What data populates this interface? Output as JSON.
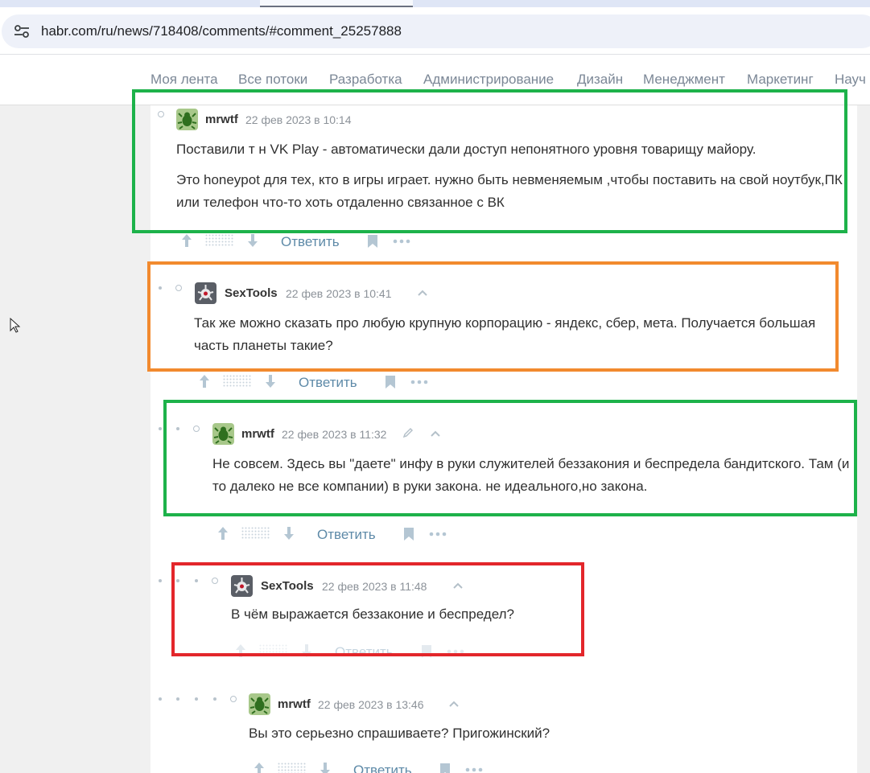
{
  "browser": {
    "url": "habr.com/ru/news/718408/comments/#comment_25257888"
  },
  "nav": {
    "items": [
      "Моя лента",
      "Все потоки",
      "Разработка",
      "Администрирование",
      "Дизайн",
      "Менеджмент",
      "Маркетинг",
      "Науч"
    ]
  },
  "comments": [
    {
      "author": "mrwtf",
      "time": "22 фев 2023 в 10:14",
      "paragraphs": [
        "Поставили т н VK Play - автоматически дали доступ непонятного уровня товарищу майору.",
        "Это honeypot для тех, кто в игры играет. нужно быть невменяемым ,чтобы поставить на свой ноутбук,ПК или телефон что-то хоть отдаленно связанное с ВК"
      ],
      "reply_label": "Ответить",
      "highlight": "green"
    },
    {
      "author": "SexTools",
      "time": "22 фев 2023 в 10:41",
      "paragraphs": [
        "Так же можно сказать про любую крупную корпорацию - яндекс, сбер, мета. Получается большая часть планеты такие?"
      ],
      "reply_label": "Ответить",
      "highlight": "orange"
    },
    {
      "author": "mrwtf",
      "time": "22 фев 2023 в 11:32",
      "paragraphs": [
        "Не совсем. Здесь вы \"даете\" инфу в руки служителей беззакония и беспредела бандитского. Там (и то далеко не все компании) в руки закона. не идеального,но закона."
      ],
      "reply_label": "Ответить",
      "highlight": "green"
    },
    {
      "author": "SexTools",
      "time": "22 фев 2023 в 11:48",
      "paragraphs": [
        "В чём выражается беззаконие и беспредел?"
      ],
      "reply_label": "Ответить",
      "highlight": "red"
    },
    {
      "author": "mrwtf",
      "time": "22 фев 2023 в 13:46",
      "paragraphs": [
        "Вы это серьезно спрашиваете? Пригожинский?"
      ],
      "reply_label": "Ответить",
      "highlight": ""
    }
  ],
  "icons": {
    "site_info": "tune-icon",
    "upvote": "arrow-up-icon",
    "downvote": "arrow-down-icon",
    "bookmark": "bookmark-icon",
    "more": "more-icon",
    "collapse": "chevron-up-icon",
    "edit": "pencil-icon",
    "cursor": "mouse-pointer-icon"
  },
  "colors": {
    "highlight_green": "#1db24a",
    "highlight_orange": "#f28a2e",
    "highlight_red": "#e3262b",
    "reply_link": "#5e8aa8"
  }
}
